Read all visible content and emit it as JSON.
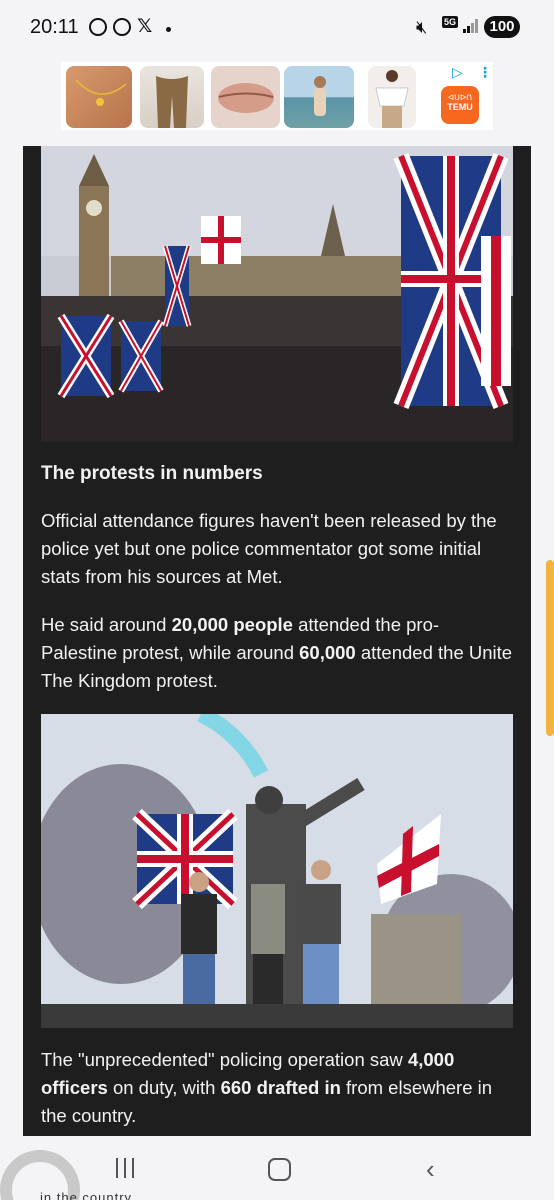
{
  "status_bar": {
    "time": "20:11",
    "icons": [
      "football-icon",
      "media-play-icon",
      "x-app-icon",
      "notification-dot"
    ],
    "right_icons": [
      "mute-icon",
      "5g-network-icon",
      "signal-icon"
    ],
    "x_glyph": "𝕏",
    "network_label": "5G",
    "battery": "100"
  },
  "ad": {
    "brand": "TEMU",
    "brand_symbol": "ᐊᑌᐅᑎ",
    "brand_color": "#f6681f",
    "choices_glyph": "▷",
    "more_glyph": "⋮",
    "thumbnails": [
      "jewelry-ad",
      "leggings-ad",
      "lip-gloss-ad",
      "swimsuit-ad",
      "blouse-ad"
    ]
  },
  "article": {
    "photo1_desc_icon": "crowd-with-union-flags-photo",
    "heading": "The protests in numbers",
    "paragraph1": "Official attendance figures haven't been released by the police yet but one police commentator got some initial stats from his sources at Met.",
    "paragraph2": {
      "part1": "He said around ",
      "bold1": "20,000 people",
      "part2": " attended the pro-Palestine protest, while around ",
      "bold2": "60,000",
      "part3": " attended the Unite The Kingdom protest."
    },
    "photo2_desc_icon": "men-on-statue-with-flags-photo",
    "paragraph3": {
      "part1": "The \"unprecedented\" policing operation saw ",
      "bold1": "4,000 officers",
      "part2": " on duty, with ",
      "bold2": "660 drafted in",
      "part3": " from elsewhere in the country."
    },
    "background_color": "#1e1e1e"
  },
  "nav_bar": {
    "back_glyph": "‹",
    "cut_text": "in the country"
  }
}
